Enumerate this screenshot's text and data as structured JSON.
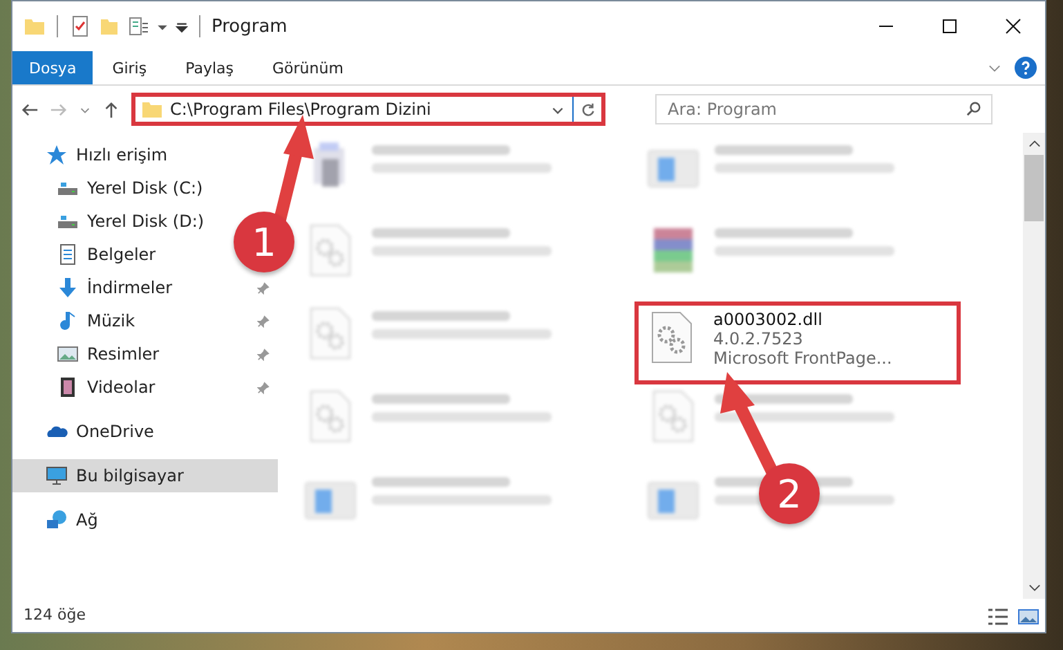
{
  "window": {
    "title": "Program"
  },
  "ribbon_tabs": [
    {
      "label": "Dosya",
      "kind": "file"
    },
    {
      "label": "Giriş",
      "kind": "tab"
    },
    {
      "label": "Paylaş",
      "kind": "tab"
    },
    {
      "label": "Görünüm",
      "kind": "tab"
    }
  ],
  "address_bar": {
    "path": "C:\\Program Files\\Program Dizini",
    "highlighted": true
  },
  "search": {
    "placeholder": "Ara: Program"
  },
  "sidebar": {
    "items": [
      {
        "label": "Hızlı erişim",
        "kind": "star",
        "selected": false,
        "children": [
          {
            "label": "Yerel Disk (C:)",
            "kind": "drive",
            "pinned": false,
            "selected": false
          },
          {
            "label": "Yerel Disk (D:)",
            "kind": "drive",
            "pinned": false,
            "selected": false
          },
          {
            "label": "Belgeler",
            "kind": "document",
            "pinned": false,
            "selected": false
          },
          {
            "label": "İndirmeler",
            "kind": "download",
            "pinned": true,
            "selected": false
          },
          {
            "label": "Müzik",
            "kind": "music",
            "pinned": true,
            "selected": false
          },
          {
            "label": "Resimler",
            "kind": "picture",
            "pinned": true,
            "selected": false
          },
          {
            "label": "Videolar",
            "kind": "film",
            "pinned": true,
            "selected": false
          }
        ]
      },
      {
        "label": "OneDrive",
        "kind": "cloud",
        "selected": false
      },
      {
        "label": "Bu bilgisayar",
        "kind": "computer",
        "selected": true
      },
      {
        "label": "Ağ",
        "kind": "network",
        "selected": false
      }
    ]
  },
  "files": [
    {
      "kind": "installer",
      "blurred": true,
      "highlighted": false
    },
    {
      "kind": "app",
      "blurred": true,
      "highlighted": false
    },
    {
      "kind": "dll",
      "blurred": true,
      "highlighted": false
    },
    {
      "kind": "archive",
      "blurred": true,
      "highlighted": false
    },
    {
      "kind": "dll",
      "blurred": true,
      "highlighted": false
    },
    {
      "kind": "dll",
      "blurred": false,
      "highlighted": true,
      "name": "a0003002.dll",
      "lines": [
        "4.0.2.7523",
        "Microsoft FrontPage..."
      ]
    },
    {
      "kind": "dll",
      "blurred": true,
      "highlighted": false
    },
    {
      "kind": "dll",
      "blurred": true,
      "highlighted": false
    },
    {
      "kind": "app",
      "blurred": true,
      "highlighted": false
    },
    {
      "kind": "app",
      "blurred": true,
      "highlighted": false
    }
  ],
  "status_bar": {
    "count": "124 öğe"
  },
  "annotations": [
    {
      "number": "1"
    },
    {
      "number": "2"
    }
  ]
}
